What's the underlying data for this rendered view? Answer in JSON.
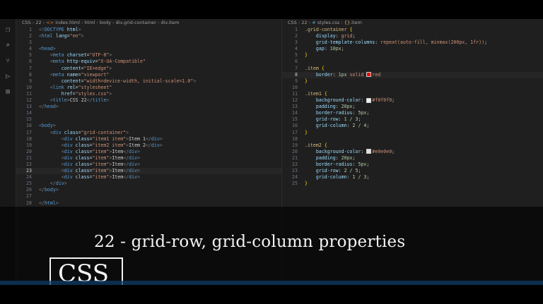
{
  "left_editor": {
    "breadcrumb": [
      "CSS",
      "22",
      "index.html",
      "html",
      "body",
      "div.grid-container",
      "div.item"
    ],
    "active_line": 23,
    "lines": [
      [
        [
          "lt",
          "<!"
        ],
        [
          "tag",
          "DOCTYPE"
        ],
        [
          "t",
          " "
        ],
        [
          "attr",
          "html"
        ],
        [
          "lt",
          ">"
        ]
      ],
      [
        [
          "lt",
          "<"
        ],
        [
          "tag",
          "html"
        ],
        [
          "t",
          " "
        ],
        [
          "attr",
          "lang"
        ],
        [
          "t",
          "="
        ],
        [
          "str",
          "\"en\""
        ],
        [
          "lt",
          ">"
        ]
      ],
      [],
      [
        [
          "lt",
          "<"
        ],
        [
          "tag",
          "head"
        ],
        [
          "lt",
          ">"
        ]
      ],
      [
        [
          "t",
          "    "
        ],
        [
          "lt",
          "<"
        ],
        [
          "tag",
          "meta"
        ],
        [
          "t",
          " "
        ],
        [
          "attr",
          "charset"
        ],
        [
          "t",
          "="
        ],
        [
          "str",
          "\"UTF-8\""
        ],
        [
          "lt",
          ">"
        ]
      ],
      [
        [
          "t",
          "    "
        ],
        [
          "lt",
          "<"
        ],
        [
          "tag",
          "meta"
        ],
        [
          "t",
          " "
        ],
        [
          "attr",
          "http-equiv"
        ],
        [
          "t",
          "="
        ],
        [
          "str",
          "\"X-UA-Compatible\""
        ]
      ],
      [
        [
          "t",
          "        "
        ],
        [
          "attr",
          "content"
        ],
        [
          "t",
          "="
        ],
        [
          "str",
          "\"IE=edge\""
        ],
        [
          "lt",
          ">"
        ]
      ],
      [
        [
          "t",
          "    "
        ],
        [
          "lt",
          "<"
        ],
        [
          "tag",
          "meta"
        ],
        [
          "t",
          " "
        ],
        [
          "attr",
          "name"
        ],
        [
          "t",
          "="
        ],
        [
          "str",
          "\"viewport\""
        ]
      ],
      [
        [
          "t",
          "        "
        ],
        [
          "attr",
          "content"
        ],
        [
          "t",
          "="
        ],
        [
          "str",
          "\"width=device-width, initial-scale=1.0\""
        ],
        [
          "lt",
          ">"
        ]
      ],
      [
        [
          "t",
          "    "
        ],
        [
          "lt",
          "<"
        ],
        [
          "tag",
          "link"
        ],
        [
          "t",
          " "
        ],
        [
          "attr",
          "rel"
        ],
        [
          "t",
          "="
        ],
        [
          "str",
          "\"stylesheet\""
        ]
      ],
      [
        [
          "t",
          "        "
        ],
        [
          "attr",
          "href"
        ],
        [
          "t",
          "="
        ],
        [
          "str",
          "\"styles.css\""
        ],
        [
          "lt",
          ">"
        ]
      ],
      [
        [
          "t",
          "    "
        ],
        [
          "lt",
          "<"
        ],
        [
          "tag",
          "title"
        ],
        [
          "lt",
          ">"
        ],
        [
          "t",
          "CSS 22"
        ],
        [
          "lt",
          "</"
        ],
        [
          "tag",
          "title"
        ],
        [
          "lt",
          ">"
        ]
      ],
      [
        [
          "lt",
          "</"
        ],
        [
          "tag",
          "head"
        ],
        [
          "lt",
          ">"
        ]
      ],
      [],
      [],
      [
        [
          "lt",
          "<"
        ],
        [
          "tag",
          "body"
        ],
        [
          "lt",
          ">"
        ]
      ],
      [
        [
          "t",
          "    "
        ],
        [
          "lt",
          "<"
        ],
        [
          "tag",
          "div"
        ],
        [
          "t",
          " "
        ],
        [
          "attr",
          "class"
        ],
        [
          "t",
          "="
        ],
        [
          "str",
          "\"grid-container\""
        ],
        [
          "lt",
          ">"
        ]
      ],
      [
        [
          "t",
          "        "
        ],
        [
          "lt",
          "<"
        ],
        [
          "tag",
          "div"
        ],
        [
          "t",
          " "
        ],
        [
          "attr",
          "class"
        ],
        [
          "t",
          "="
        ],
        [
          "str",
          "\"item1 item\""
        ],
        [
          "lt",
          ">"
        ],
        [
          "t",
          "Item 1"
        ],
        [
          "lt",
          "</"
        ],
        [
          "tag",
          "div"
        ],
        [
          "lt",
          ">"
        ]
      ],
      [
        [
          "t",
          "        "
        ],
        [
          "lt",
          "<"
        ],
        [
          "tag",
          "div"
        ],
        [
          "t",
          " "
        ],
        [
          "attr",
          "class"
        ],
        [
          "t",
          "="
        ],
        [
          "str",
          "\"item2 item\""
        ],
        [
          "lt",
          ">"
        ],
        [
          "t",
          "Item 2"
        ],
        [
          "lt",
          "</"
        ],
        [
          "tag",
          "div"
        ],
        [
          "lt",
          ">"
        ]
      ],
      [
        [
          "t",
          "        "
        ],
        [
          "lt",
          "<"
        ],
        [
          "tag",
          "div"
        ],
        [
          "t",
          " "
        ],
        [
          "attr",
          "class"
        ],
        [
          "t",
          "="
        ],
        [
          "str",
          "\"item\""
        ],
        [
          "lt",
          ">"
        ],
        [
          "t",
          "Item"
        ],
        [
          "lt",
          "</"
        ],
        [
          "tag",
          "div"
        ],
        [
          "lt",
          ">"
        ]
      ],
      [
        [
          "t",
          "        "
        ],
        [
          "lt",
          "<"
        ],
        [
          "tag",
          "div"
        ],
        [
          "t",
          " "
        ],
        [
          "attr",
          "class"
        ],
        [
          "t",
          "="
        ],
        [
          "str",
          "\"item\""
        ],
        [
          "lt",
          ">"
        ],
        [
          "t",
          "Item"
        ],
        [
          "lt",
          "</"
        ],
        [
          "tag",
          "div"
        ],
        [
          "lt",
          ">"
        ]
      ],
      [
        [
          "t",
          "        "
        ],
        [
          "lt",
          "<"
        ],
        [
          "tag",
          "div"
        ],
        [
          "t",
          " "
        ],
        [
          "attr",
          "class"
        ],
        [
          "t",
          "="
        ],
        [
          "str",
          "\"item\""
        ],
        [
          "lt",
          ">"
        ],
        [
          "t",
          "Item"
        ],
        [
          "lt",
          "</"
        ],
        [
          "tag",
          "div"
        ],
        [
          "lt",
          ">"
        ]
      ],
      [
        [
          "t",
          "        "
        ],
        [
          "lt",
          "<"
        ],
        [
          "tag",
          "div"
        ],
        [
          "t",
          " "
        ],
        [
          "attr",
          "class"
        ],
        [
          "t",
          "="
        ],
        [
          "str",
          "\"item\""
        ],
        [
          "lt",
          ">"
        ],
        [
          "t",
          "Item"
        ],
        [
          "lt",
          "</"
        ],
        [
          "tag",
          "div"
        ],
        [
          "lt",
          ">"
        ]
      ],
      [
        [
          "t",
          "        "
        ],
        [
          "lt",
          "<"
        ],
        [
          "tag",
          "div"
        ],
        [
          "t",
          " "
        ],
        [
          "attr",
          "class"
        ],
        [
          "t",
          "="
        ],
        [
          "str",
          "\"item\""
        ],
        [
          "lt",
          ">"
        ],
        [
          "t",
          "Item"
        ],
        [
          "lt",
          "</"
        ],
        [
          "tag",
          "div"
        ],
        [
          "lt",
          ">"
        ]
      ],
      [
        [
          "t",
          "    "
        ],
        [
          "lt",
          "</"
        ],
        [
          "tag",
          "div"
        ],
        [
          "lt",
          ">"
        ]
      ],
      [
        [
          "lt",
          "</"
        ],
        [
          "tag",
          "body"
        ],
        [
          "lt",
          ">"
        ]
      ],
      [],
      [
        [
          "lt",
          "</"
        ],
        [
          "tag",
          "html"
        ],
        [
          "lt",
          ">"
        ]
      ]
    ]
  },
  "right_editor": {
    "breadcrumb": [
      "CSS",
      "22",
      "#",
      "styles.css",
      "{}",
      ".item"
    ],
    "active_line": 8,
    "lines": [
      [
        [
          "sel",
          ".grid-container"
        ],
        [
          "t",
          " "
        ],
        [
          "brace",
          "{"
        ]
      ],
      [
        [
          "t",
          "    "
        ],
        [
          "prop",
          "display"
        ],
        [
          "t",
          ": "
        ],
        [
          "val",
          "grid"
        ],
        [
          "t",
          ";"
        ]
      ],
      [
        [
          "t",
          "    "
        ],
        [
          "prop",
          "grid-template-columns"
        ],
        [
          "t",
          ": "
        ],
        [
          "val",
          "repeat(auto-fill, minmax(200px, 1fr))"
        ],
        [
          "t",
          ";"
        ]
      ],
      [
        [
          "t",
          "    "
        ],
        [
          "prop",
          "gap"
        ],
        [
          "t",
          ": "
        ],
        [
          "num",
          "10px"
        ],
        [
          "t",
          ";"
        ]
      ],
      [
        [
          "brace",
          "}"
        ]
      ],
      [],
      [
        [
          "sel",
          ".item"
        ],
        [
          "t",
          " "
        ],
        [
          "brace",
          "{"
        ]
      ],
      [
        [
          "t",
          "    "
        ],
        [
          "prop",
          "border"
        ],
        [
          "t",
          ": "
        ],
        [
          "num",
          "1px"
        ],
        [
          "t",
          " "
        ],
        [
          "val",
          "solid"
        ],
        [
          "t",
          " "
        ],
        [
          "swatch",
          "#ff0000"
        ],
        [
          "val",
          "red"
        ]
      ],
      [
        [
          "brace",
          "}"
        ]
      ],
      [],
      [
        [
          "sel",
          ".item1"
        ],
        [
          "t",
          " "
        ],
        [
          "brace",
          "{"
        ]
      ],
      [
        [
          "t",
          "    "
        ],
        [
          "prop",
          "background-color"
        ],
        [
          "t",
          ": "
        ],
        [
          "swatch",
          "#f0f0f0"
        ],
        [
          "val",
          "#f0f0f0"
        ],
        [
          "t",
          ";"
        ]
      ],
      [
        [
          "t",
          "    "
        ],
        [
          "prop",
          "padding"
        ],
        [
          "t",
          ": "
        ],
        [
          "num",
          "20px"
        ],
        [
          "t",
          ";"
        ]
      ],
      [
        [
          "t",
          "    "
        ],
        [
          "prop",
          "border-radius"
        ],
        [
          "t",
          ": "
        ],
        [
          "num",
          "5px"
        ],
        [
          "t",
          ";"
        ]
      ],
      [
        [
          "t",
          "    "
        ],
        [
          "prop",
          "grid-row"
        ],
        [
          "t",
          ": "
        ],
        [
          "num",
          "1 / 3"
        ],
        [
          "t",
          ";"
        ]
      ],
      [
        [
          "t",
          "    "
        ],
        [
          "prop",
          "grid-column"
        ],
        [
          "t",
          ": "
        ],
        [
          "num",
          "2 / 4"
        ],
        [
          "t",
          ";"
        ]
      ],
      [
        [
          "brace",
          "}"
        ]
      ],
      [],
      [
        [
          "sel",
          ".item2"
        ],
        [
          "t",
          " "
        ],
        [
          "brace",
          "{"
        ]
      ],
      [
        [
          "t",
          "    "
        ],
        [
          "prop",
          "background-color"
        ],
        [
          "t",
          ": "
        ],
        [
          "swatch",
          "#e0e0e0"
        ],
        [
          "val",
          "#e0e0e0"
        ],
        [
          "t",
          ";"
        ]
      ],
      [
        [
          "t",
          "    "
        ],
        [
          "prop",
          "padding"
        ],
        [
          "t",
          ": "
        ],
        [
          "num",
          "20px"
        ],
        [
          "t",
          ";"
        ]
      ],
      [
        [
          "t",
          "    "
        ],
        [
          "prop",
          "border-radius"
        ],
        [
          "t",
          ": "
        ],
        [
          "num",
          "5px"
        ],
        [
          "t",
          ";"
        ]
      ],
      [
        [
          "t",
          "    "
        ],
        [
          "prop",
          "grid-row"
        ],
        [
          "t",
          ": "
        ],
        [
          "num",
          "2 / 5"
        ],
        [
          "t",
          ";"
        ]
      ],
      [
        [
          "t",
          "    "
        ],
        [
          "prop",
          "grid-column"
        ],
        [
          "t",
          ": "
        ],
        [
          "num",
          "1 / 3"
        ],
        [
          "t",
          ";"
        ]
      ],
      [
        [
          "brace",
          "}"
        ]
      ]
    ]
  },
  "overlay": {
    "title": "22 - grid-row, grid-column properties",
    "logo": "CSS"
  },
  "icons": {
    "activity": [
      "files-icon",
      "search-icon",
      "source-control-icon",
      "run-debug-icon",
      "extensions-icon"
    ]
  }
}
